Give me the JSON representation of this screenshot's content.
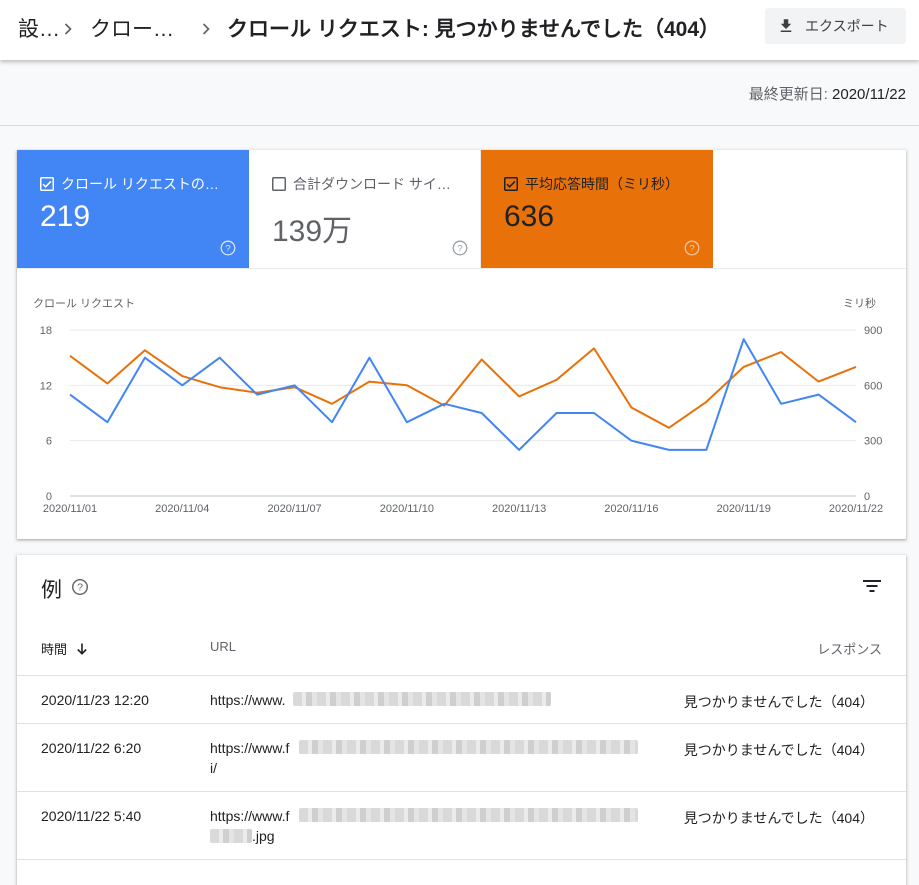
{
  "header": {
    "breadcrumbs": [
      "設…",
      "クロー…",
      "クロール リクエスト: 見つかりませんでした（404）"
    ],
    "export_label": "エクスポート"
  },
  "updated": {
    "label": "最終更新日: ",
    "value": "2020/11/22"
  },
  "metrics": [
    {
      "title": "クロール リクエストの…",
      "value": "219",
      "checked": true,
      "color": "#4285f4"
    },
    {
      "title": "合計ダウンロード サイ…",
      "value": "139万",
      "checked": false,
      "color": "#ffffff"
    },
    {
      "title": "平均応答時間（ミリ秒）",
      "value": "636",
      "checked": true,
      "color": "#e8710a"
    }
  ],
  "chart_data": {
    "type": "line",
    "left_axis_label": "クロール リクエスト",
    "right_axis_label": "ミリ秒",
    "left_ticks": [
      "0",
      "6",
      "12",
      "18"
    ],
    "right_ticks": [
      "0",
      "300",
      "600",
      "900"
    ],
    "ylim_left": [
      0,
      18
    ],
    "ylim_right": [
      0,
      900
    ],
    "x_tick_labels": [
      "2020/11/01",
      "2020/11/04",
      "2020/11/07",
      "2020/11/10",
      "2020/11/13",
      "2020/11/16",
      "2020/11/19",
      "2020/11/22"
    ],
    "series": [
      {
        "color": "#4285f4",
        "axis": "left",
        "values": [
          11,
          8,
          15,
          12,
          15,
          11,
          12,
          8,
          15,
          8,
          10,
          9,
          5,
          9,
          9,
          6,
          5,
          5,
          17,
          10,
          11,
          8
        ]
      },
      {
        "color": "#e8710a",
        "axis": "right",
        "values": [
          760,
          610,
          790,
          650,
          590,
          560,
          590,
          500,
          620,
          600,
          490,
          740,
          540,
          630,
          800,
          480,
          370,
          510,
          700,
          780,
          620,
          700
        ]
      }
    ]
  },
  "examples": {
    "title": "例",
    "columns": {
      "time": "時間",
      "url": "URL",
      "response": "レスポンス"
    },
    "rows": [
      {
        "time": "2020/11/23 12:20",
        "url": "https://www.",
        "url2": "",
        "response": "見つかりませんでした（404）"
      },
      {
        "time": "2020/11/22 6:20",
        "url": "https://www.f",
        "url2": "i/",
        "response": "見つかりませんでした（404）"
      },
      {
        "time": "2020/11/22 5:40",
        "url": "https://www.f",
        "url2": ".jpg",
        "response": "見つかりませんでした（404）"
      }
    ]
  }
}
